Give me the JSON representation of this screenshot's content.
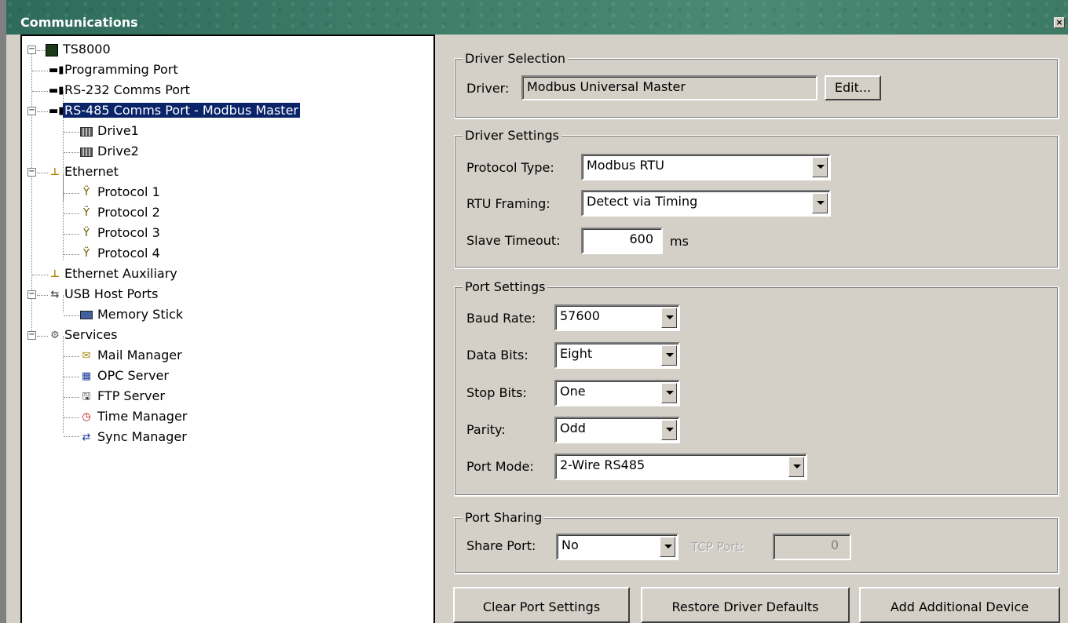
{
  "window": {
    "title": "Communications",
    "close_glyph": "×"
  },
  "tree": {
    "items": [
      {
        "label": "TS8000",
        "icon": "ts8000-device-icon"
      },
      {
        "label": "Programming Port",
        "icon": "port-plug-icon"
      },
      {
        "label": "RS-232 Comms Port",
        "icon": "port-plug-icon"
      },
      {
        "label": "RS-485 Comms Port - Modbus Master",
        "icon": "port-plug-icon"
      },
      {
        "label": "Drive1",
        "icon": "device-block-icon"
      },
      {
        "label": "Drive2",
        "icon": "device-block-icon"
      },
      {
        "label": "Ethernet",
        "icon": "ethernet-icon"
      },
      {
        "label": "Protocol 1",
        "icon": "protocol-icon"
      },
      {
        "label": "Protocol 2",
        "icon": "protocol-icon"
      },
      {
        "label": "Protocol 3",
        "icon": "protocol-icon"
      },
      {
        "label": "Protocol 4",
        "icon": "protocol-icon"
      },
      {
        "label": "Ethernet Auxiliary",
        "icon": "ethernet-icon"
      },
      {
        "label": "USB Host Ports",
        "icon": "usb-icon"
      },
      {
        "label": "Memory Stick",
        "icon": "memory-stick-icon"
      },
      {
        "label": "Services",
        "icon": "services-gears-icon"
      },
      {
        "label": "Mail Manager",
        "icon": "mail-icon"
      },
      {
        "label": "OPC Server",
        "icon": "opc-server-icon"
      },
      {
        "label": "FTP Server",
        "icon": "ftp-server-icon"
      },
      {
        "label": "Time Manager",
        "icon": "time-manager-icon"
      },
      {
        "label": "Sync Manager",
        "icon": "sync-manager-icon"
      }
    ],
    "selected": "RS-485 Comms Port - Modbus Master"
  },
  "driver_selection": {
    "legend": "Driver Selection",
    "driver_label": "Driver:",
    "driver_value": "Modbus Universal Master",
    "edit_button": "Edit..."
  },
  "driver_settings": {
    "legend": "Driver Settings",
    "protocol_type_label": "Protocol Type:",
    "protocol_type_value": "Modbus RTU",
    "rtu_framing_label": "RTU Framing:",
    "rtu_framing_value": "Detect via Timing",
    "slave_timeout_label": "Slave Timeout:",
    "slave_timeout_value": "600",
    "slave_timeout_unit": "ms"
  },
  "port_settings": {
    "legend": "Port Settings",
    "baud_rate_label": "Baud Rate:",
    "baud_rate_value": "57600",
    "data_bits_label": "Data Bits:",
    "data_bits_value": "Eight",
    "stop_bits_label": "Stop Bits:",
    "stop_bits_value": "One",
    "parity_label": "Parity:",
    "parity_value": "Odd",
    "port_mode_label": "Port Mode:",
    "port_mode_value": "2-Wire RS485"
  },
  "port_sharing": {
    "legend": "Port Sharing",
    "share_port_label": "Share Port:",
    "share_port_value": "No",
    "tcp_port_label": "TCP Port:",
    "tcp_port_value": "0"
  },
  "buttons": {
    "clear": "Clear Port Settings",
    "restore": "Restore Driver Defaults",
    "add": "Add Additional Device"
  },
  "colors": {
    "selection": "#0a246a",
    "title_bar": "#3f7f6a",
    "face": "#d4d0c8"
  }
}
